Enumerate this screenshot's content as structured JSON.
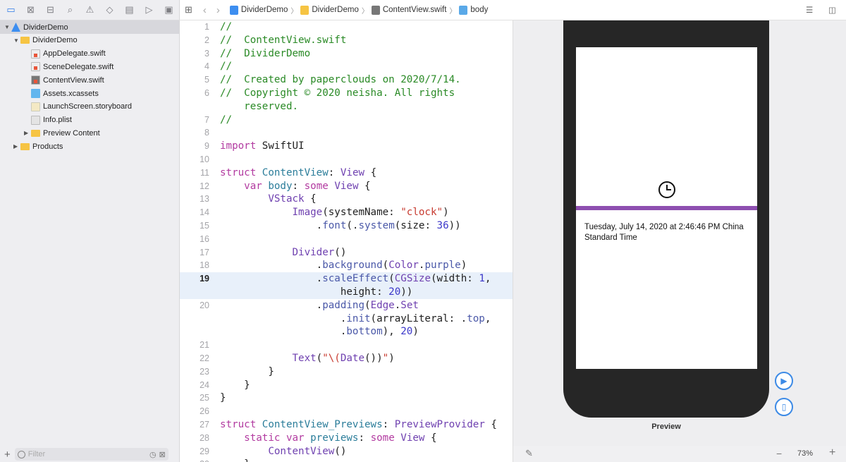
{
  "navigator": {
    "toolbar_icons": [
      "folder-icon",
      "source-control-icon",
      "hierarchy-icon",
      "search-icon",
      "warning-icon",
      "test-icon",
      "debug-icon",
      "breakpoint-icon",
      "report-icon"
    ],
    "tree": [
      {
        "label": "DividerDemo",
        "icon": "project",
        "depth": 0,
        "disclosure": "open",
        "selected": true
      },
      {
        "label": "DividerDemo",
        "icon": "folder",
        "depth": 1,
        "disclosure": "open"
      },
      {
        "label": "AppDelegate.swift",
        "icon": "swift",
        "depth": 2
      },
      {
        "label": "SceneDelegate.swift",
        "icon": "swift",
        "depth": 2
      },
      {
        "label": "ContentView.swift",
        "icon": "swift-dark",
        "depth": 2
      },
      {
        "label": "Assets.xcassets",
        "icon": "assets",
        "depth": 2
      },
      {
        "label": "LaunchScreen.storyboard",
        "icon": "story",
        "depth": 2
      },
      {
        "label": "Info.plist",
        "icon": "plist",
        "depth": 2
      },
      {
        "label": "Preview Content",
        "icon": "folder",
        "depth": 2,
        "disclosure": "closed"
      },
      {
        "label": "Products",
        "icon": "folder",
        "depth": 1,
        "disclosure": "closed"
      }
    ],
    "filter_placeholder": "Filter"
  },
  "breadcrumb": [
    "DividerDemo",
    "DividerDemo",
    "ContentView.swift",
    "body"
  ],
  "editor": {
    "current_line": 19,
    "rows": [
      {
        "n": 1,
        "t": [
          [
            "//",
            "comment"
          ]
        ]
      },
      {
        "n": 2,
        "t": [
          [
            "//  ContentView.swift",
            "comment"
          ]
        ]
      },
      {
        "n": 3,
        "t": [
          [
            "//  DividerDemo",
            "comment"
          ]
        ]
      },
      {
        "n": 4,
        "t": [
          [
            "//",
            "comment"
          ]
        ]
      },
      {
        "n": 5,
        "t": [
          [
            "//  Created by papercloud​s on 2020/7/14.",
            "comment"
          ]
        ]
      },
      {
        "n": 6,
        "t": [
          [
            "//  Copyright © 2020 neisha. All rights",
            "comment"
          ]
        ]
      },
      {
        "n": null,
        "t": [
          [
            "    reserved.",
            "comment"
          ]
        ]
      },
      {
        "n": 7,
        "t": [
          [
            "//",
            "comment"
          ]
        ]
      },
      {
        "n": 8,
        "t": []
      },
      {
        "n": 9,
        "t": [
          [
            "import",
            "kw"
          ],
          [
            " SwiftUI",
            "plain"
          ]
        ]
      },
      {
        "n": 10,
        "t": []
      },
      {
        "n": 11,
        "t": [
          [
            "struct",
            "kw"
          ],
          [
            " ",
            "plain"
          ],
          [
            "ContentView",
            "decl"
          ],
          [
            ": ",
            "plain"
          ],
          [
            "View",
            "type"
          ],
          [
            " {",
            "plain"
          ]
        ]
      },
      {
        "n": 12,
        "t": [
          [
            "    ",
            "plain"
          ],
          [
            "var",
            "kw"
          ],
          [
            " ",
            "plain"
          ],
          [
            "body",
            "decl"
          ],
          [
            ": ",
            "plain"
          ],
          [
            "some",
            "kw"
          ],
          [
            " ",
            "plain"
          ],
          [
            "View",
            "type"
          ],
          [
            " {",
            "plain"
          ]
        ]
      },
      {
        "n": 13,
        "t": [
          [
            "        ",
            "plain"
          ],
          [
            "VStack",
            "type"
          ],
          [
            " {",
            "plain"
          ]
        ]
      },
      {
        "n": 14,
        "t": [
          [
            "            ",
            "plain"
          ],
          [
            "Image",
            "type"
          ],
          [
            "(systemName: ",
            "plain"
          ],
          [
            "\"clock\"",
            "str"
          ],
          [
            ")",
            "plain"
          ]
        ]
      },
      {
        "n": 15,
        "t": [
          [
            "                .",
            "plain"
          ],
          [
            "font",
            "method"
          ],
          [
            "(.",
            "plain"
          ],
          [
            "system",
            "method"
          ],
          [
            "(size: ",
            "plain"
          ],
          [
            "36",
            "num"
          ],
          [
            "))",
            "plain"
          ]
        ]
      },
      {
        "n": 16,
        "t": []
      },
      {
        "n": 17,
        "t": [
          [
            "            ",
            "plain"
          ],
          [
            "Divider",
            "type"
          ],
          [
            "()",
            "plain"
          ]
        ]
      },
      {
        "n": 18,
        "t": [
          [
            "                .",
            "plain"
          ],
          [
            "background",
            "method"
          ],
          [
            "(",
            "plain"
          ],
          [
            "Color",
            "type"
          ],
          [
            ".",
            "plain"
          ],
          [
            "purple",
            "method"
          ],
          [
            ")",
            "plain"
          ]
        ]
      },
      {
        "n": 19,
        "t": [
          [
            "                .",
            "plain"
          ],
          [
            "scaleEffect",
            "method"
          ],
          [
            "(",
            "plain"
          ],
          [
            "CGSize",
            "type"
          ],
          [
            "(width: ",
            "plain"
          ],
          [
            "1",
            "num"
          ],
          [
            ",",
            "plain"
          ]
        ]
      },
      {
        "n": null,
        "cont_of": 19,
        "t": [
          [
            "                    height: ",
            "plain"
          ],
          [
            "20",
            "num"
          ],
          [
            "))",
            "plain"
          ]
        ]
      },
      {
        "n": 20,
        "t": [
          [
            "                .",
            "plain"
          ],
          [
            "padding",
            "method"
          ],
          [
            "(",
            "plain"
          ],
          [
            "Edge",
            "type"
          ],
          [
            ".",
            "plain"
          ],
          [
            "Set",
            "type"
          ]
        ]
      },
      {
        "n": null,
        "t": [
          [
            "                    .",
            "plain"
          ],
          [
            "init",
            "method"
          ],
          [
            "(arrayLiteral: .",
            "plain"
          ],
          [
            "top",
            "method"
          ],
          [
            ",",
            "plain"
          ]
        ]
      },
      {
        "n": null,
        "t": [
          [
            "                    .",
            "plain"
          ],
          [
            "bottom",
            "method"
          ],
          [
            "), ",
            "plain"
          ],
          [
            "20",
            "num"
          ],
          [
            ")",
            "plain"
          ]
        ]
      },
      {
        "n": 21,
        "t": []
      },
      {
        "n": 22,
        "t": [
          [
            "            ",
            "plain"
          ],
          [
            "Text",
            "type"
          ],
          [
            "(",
            "plain"
          ],
          [
            "\"\\(",
            "str"
          ],
          [
            "Date",
            "type"
          ],
          [
            "())",
            "plain"
          ],
          [
            "\"",
            "str"
          ],
          [
            ")",
            "plain"
          ]
        ]
      },
      {
        "n": 23,
        "t": [
          [
            "        }",
            "plain"
          ]
        ]
      },
      {
        "n": 24,
        "t": [
          [
            "    }",
            "plain"
          ]
        ]
      },
      {
        "n": 25,
        "t": [
          [
            "}",
            "plain"
          ]
        ]
      },
      {
        "n": 26,
        "t": []
      },
      {
        "n": 27,
        "t": [
          [
            "struct",
            "kw"
          ],
          [
            " ",
            "plain"
          ],
          [
            "ContentView_Previews",
            "decl"
          ],
          [
            ": ",
            "plain"
          ],
          [
            "PreviewProvider",
            "type"
          ],
          [
            " {",
            "plain"
          ]
        ]
      },
      {
        "n": 28,
        "t": [
          [
            "    ",
            "plain"
          ],
          [
            "static",
            "kw"
          ],
          [
            " ",
            "plain"
          ],
          [
            "var",
            "kw"
          ],
          [
            " ",
            "plain"
          ],
          [
            "previews",
            "decl"
          ],
          [
            ": ",
            "plain"
          ],
          [
            "some",
            "kw"
          ],
          [
            " ",
            "plain"
          ],
          [
            "View",
            "type"
          ],
          [
            " {",
            "plain"
          ]
        ]
      },
      {
        "n": 29,
        "t": [
          [
            "        ",
            "plain"
          ],
          [
            "ContentView",
            "type"
          ],
          [
            "()",
            "plain"
          ]
        ]
      },
      {
        "n": 30,
        "t": [
          [
            "    }",
            "plain"
          ]
        ]
      }
    ]
  },
  "preview": {
    "date_text": "Tuesday, July 14, 2020 at 2:46:46 PM China Standard Time",
    "label": "Preview",
    "zoom": "73%",
    "zoom_out": "−",
    "zoom_in": "+",
    "divider_color": "#8e4fb0"
  }
}
